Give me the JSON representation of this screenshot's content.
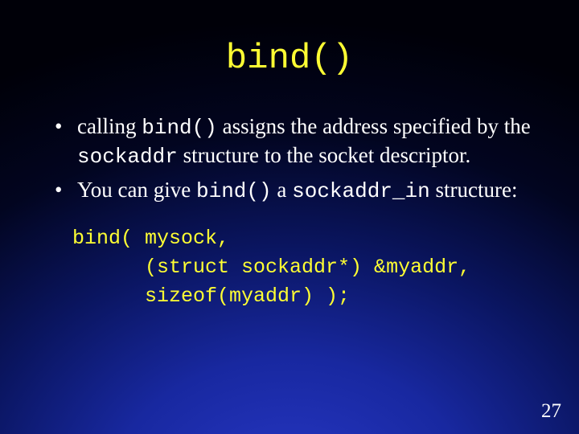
{
  "slide": {
    "title": "bind()",
    "bullets": [
      {
        "pre1": "calling ",
        "mono1": "bind()",
        "mid1": "  assigns the address specified by the ",
        "mono2": "sockaddr",
        "post1": " structure to the socket descriptor."
      },
      {
        "pre1": "You can give ",
        "mono1": "bind()",
        "mid1": " a ",
        "mono2": "sockaddr_in",
        "post1": " structure:"
      }
    ],
    "code": "bind( mysock,\n      (struct sockaddr*) &myaddr,\n      sizeof(myaddr) );",
    "page_number": "27"
  }
}
